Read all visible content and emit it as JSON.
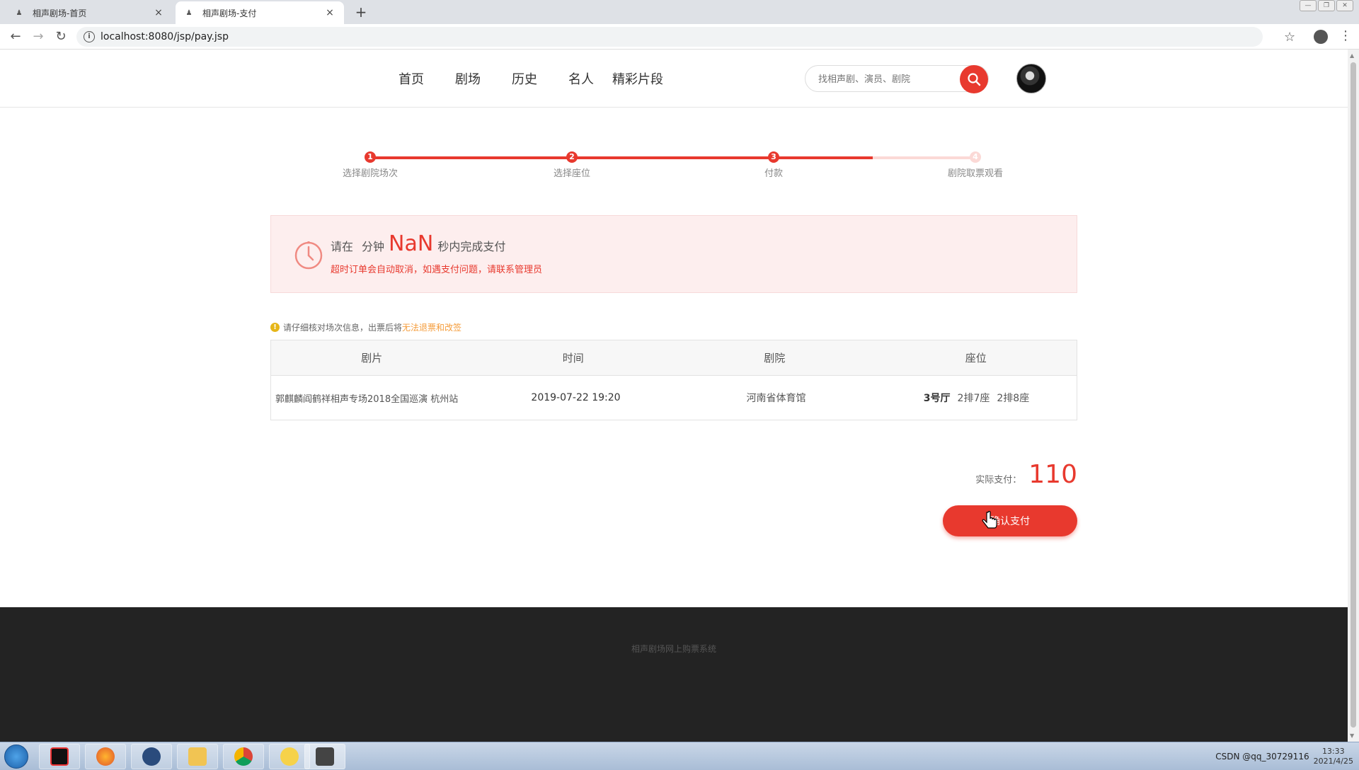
{
  "browser": {
    "tabs": [
      {
        "title": "相声剧场-首页",
        "close": "×"
      },
      {
        "title": "相声剧场-支付",
        "close": "×"
      }
    ],
    "new_tab": "+",
    "url": "localhost:8080/jsp/pay.jsp"
  },
  "header": {
    "nav": [
      "首页",
      "剧场",
      "历史",
      "名人",
      "精彩片段"
    ],
    "search_placeholder": "找相声剧、演员、剧院"
  },
  "steps": [
    {
      "num": "1",
      "label": "选择剧院场次",
      "done": true
    },
    {
      "num": "2",
      "label": "选择座位",
      "done": true
    },
    {
      "num": "3",
      "label": "付款",
      "done": true
    },
    {
      "num": "4",
      "label": "剧院取票观看",
      "done": false
    }
  ],
  "notice": {
    "prefix": "请在",
    "minute_unit": "分钟",
    "seconds_value": "NaN",
    "suffix": "秒内完成支付",
    "warning": "超时订单会自动取消，如遇支付问题，请联系管理员"
  },
  "hint": {
    "icon": "!",
    "text": "请仔细核对场次信息，出票后将",
    "highlight": "无法退票和改签"
  },
  "table": {
    "headers": [
      "剧片",
      "时间",
      "剧院",
      "座位"
    ],
    "row": {
      "movie": "郭麒麟阎鹤祥相声专场2018全国巡演 杭州站",
      "time": "2019-07-22 19:20",
      "theater": "河南省体育馆",
      "hall": "3号厅",
      "seats": [
        "2排7座",
        "2排8座"
      ]
    }
  },
  "payment": {
    "label": "实际支付：",
    "amount": "110",
    "button": "确认支付"
  },
  "footer": {
    "text": "相声剧场网上购票系统"
  },
  "taskbar": {
    "tray_text": "CSDN @qq_30729116",
    "time": "13:33",
    "date": "2021/4/25"
  },
  "colors": {
    "accent": "#e8392e",
    "notice_bg": "#fdeeee",
    "footer_bg": "#232323"
  }
}
